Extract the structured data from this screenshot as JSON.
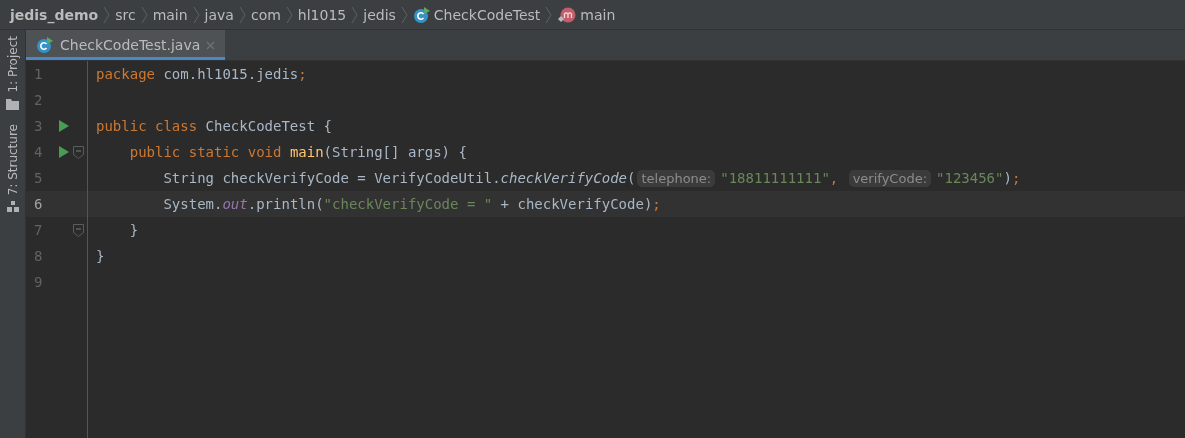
{
  "breadcrumbs": [
    {
      "text": "jedis_demo",
      "kind": "project"
    },
    {
      "text": "src",
      "kind": "folder"
    },
    {
      "text": "main",
      "kind": "folder"
    },
    {
      "text": "java",
      "kind": "folder"
    },
    {
      "text": "com",
      "kind": "folder"
    },
    {
      "text": "hl1015",
      "kind": "folder"
    },
    {
      "text": "jedis",
      "kind": "folder"
    },
    {
      "text": "CheckCodeTest",
      "kind": "class"
    },
    {
      "text": "main",
      "kind": "method"
    }
  ],
  "tool_windows": [
    {
      "label": "1: Project",
      "kind": "folder"
    },
    {
      "label": "7: Structure",
      "kind": "structure"
    }
  ],
  "tabs": [
    {
      "label": "CheckCodeTest.java",
      "selected": true
    }
  ],
  "lines": [
    {
      "number": "1",
      "run": false,
      "fold": false,
      "current": false,
      "tokens": [
        {
          "text": "package ",
          "kind": "keyword"
        },
        {
          "text": "com.hl1015.jedis",
          "kind": "plain"
        },
        {
          "text": ";",
          "kind": "punct"
        }
      ]
    },
    {
      "number": "2",
      "run": false,
      "fold": false,
      "current": false
    },
    {
      "number": "3",
      "run": true,
      "fold": false,
      "current": false,
      "tokens": [
        {
          "text": "public class ",
          "kind": "keyword"
        },
        {
          "text": "CheckCodeTest {",
          "kind": "plain"
        }
      ]
    },
    {
      "number": "4",
      "run": true,
      "fold": true,
      "current": false,
      "tokens": [
        {
          "text": "    public static void ",
          "kind": "keyword"
        },
        {
          "text": "main",
          "kind": "declaration"
        },
        {
          "text": "(String[] args) {",
          "kind": "plain"
        }
      ]
    },
    {
      "number": "5",
      "run": false,
      "fold": false,
      "current": false,
      "tokens": [
        {
          "text": "        String checkVerifyCode = VerifyCodeUtil.",
          "kind": "plain"
        },
        {
          "text": "checkVerifyCode",
          "kind": "italic"
        },
        {
          "text": "(",
          "kind": "plain"
        },
        {
          "text": "telephone:",
          "kind": "hint"
        },
        {
          "text": "\"18811111111\"",
          "kind": "string"
        },
        {
          "text": ", ",
          "kind": "punct"
        },
        {
          "text": "verifyCode:",
          "kind": "hint"
        },
        {
          "text": "\"123456\"",
          "kind": "string"
        },
        {
          "text": ")",
          "kind": "plain"
        },
        {
          "text": ";",
          "kind": "punct"
        }
      ]
    },
    {
      "number": "6",
      "run": false,
      "fold": false,
      "current": true,
      "tokens": [
        {
          "text": "        System.",
          "kind": "plain"
        },
        {
          "text": "out",
          "kind": "static"
        },
        {
          "text": ".println(",
          "kind": "plain"
        },
        {
          "text": "\"checkVerifyCode = \"",
          "kind": "string"
        },
        {
          "text": " + checkVerifyCode)",
          "kind": "plain"
        },
        {
          "text": ";",
          "kind": "punct"
        }
      ]
    },
    {
      "number": "7",
      "run": false,
      "fold": true,
      "current": false,
      "tokens": [
        {
          "text": "    }",
          "kind": "plain"
        }
      ]
    },
    {
      "number": "8",
      "run": false,
      "fold": false,
      "current": false,
      "tokens": [
        {
          "text": "}",
          "kind": "plain"
        }
      ]
    },
    {
      "number": "9",
      "run": false,
      "fold": false,
      "current": false
    }
  ]
}
